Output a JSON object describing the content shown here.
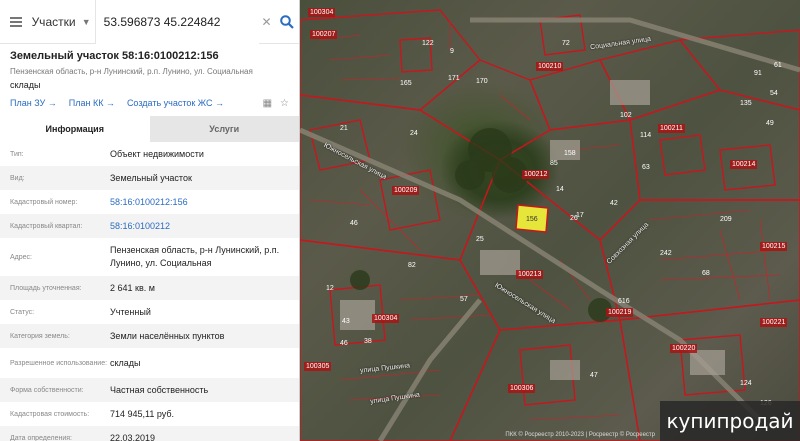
{
  "search": {
    "category": "Участки",
    "query": "53.596873 45.224842"
  },
  "parcel": {
    "title": "Земельный участок 58:16:0100212:156",
    "address": "Пензенская область, р-н Лунинский, р.п. Лунино, ул. Социальная",
    "use": "склады",
    "links": [
      "План ЗУ →",
      "План КК →",
      "Создать участок ЖС →"
    ]
  },
  "tabs": [
    "Информация",
    "Услуги"
  ],
  "info_rows": [
    {
      "key": "Тип:",
      "value": "Объект недвижимости"
    },
    {
      "key": "Вид:",
      "value": "Земельный участок"
    },
    {
      "key": "Кадастровый номер:",
      "value": "58:16:0100212:156"
    },
    {
      "key": "Кадастровый квартал:",
      "value": "58:16:0100212"
    },
    {
      "key": "Адрес:",
      "value": "Пензенская область, р-н Лунинский, р.п. Лунино, ул. Социальная"
    },
    {
      "key": "Площадь уточненная:",
      "value": "2 641 кв. м"
    },
    {
      "key": "Статус:",
      "value": "Учтенный"
    },
    {
      "key": "Категория земель:",
      "value": "Земли населённых пунктов"
    },
    {
      "key": "Разрешенное использование:",
      "value": "склады"
    },
    {
      "key": "Форма собственности:",
      "value": "Частная собственность"
    },
    {
      "key": "Кадастровая стоимость:",
      "value": "714 945,11 руб."
    },
    {
      "key": "Дата определения:",
      "value": "22.03.2019"
    }
  ],
  "map": {
    "quarter_labels": [
      "100207",
      "100210",
      "100211",
      "100214",
      "100212",
      "100209",
      "100213",
      "100219",
      "100221",
      "100304",
      "100305",
      "100306",
      "100304",
      "100220",
      "100215"
    ],
    "street_labels": [
      "Социальная улица",
      "Южносельская улица",
      "Южносельская улица",
      "улица Пушкина",
      "улица Пушкина",
      "Совхозная улица"
    ],
    "highlight_label": "156",
    "numbers": [
      "122",
      "9",
      "171",
      "170",
      "72",
      "165",
      "158",
      "14",
      "21",
      "24",
      "26",
      "42",
      "82",
      "25",
      "46",
      "616",
      "46",
      "12",
      "54",
      "135",
      "61",
      "49",
      "91",
      "17",
      "85",
      "102",
      "114",
      "242",
      "209",
      "68",
      "47",
      "38",
      "43",
      "57",
      "124",
      "126",
      "63"
    ],
    "copyright": "ПКК © Росреестр 2010-2023 | Росреестр © Росреестр"
  },
  "watermark": "купипродай"
}
